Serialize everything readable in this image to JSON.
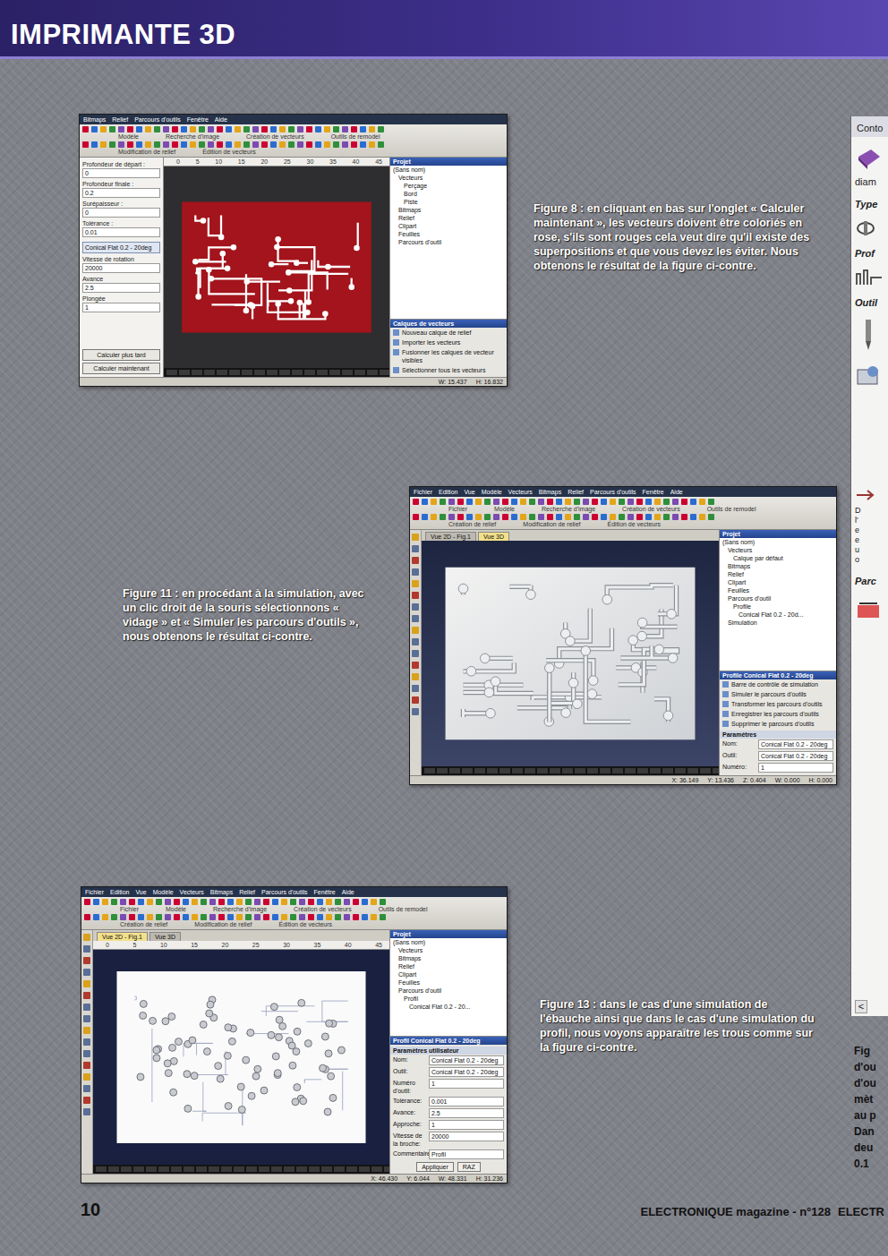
{
  "header": {
    "title": "IMPRIMANTE 3D"
  },
  "figures": [
    {
      "caption": "Figure 8 : en cliquant en bas sur l'onglet « Calculer maintenant », les vecteurs doivent être coloriés en rose, s'ils sont rouges cela veut dire qu'il existe des superpositions et que vous devez les éviter. Nous obtenons le résultat de la figure ci-contre.",
      "screen": {
        "menu": [
          "Bitmaps",
          "Relief",
          "Parcours d'outils",
          "Fenêtre",
          "Aide"
        ],
        "toolbar_labels": [
          "Modèle",
          "Recherche d'image",
          "Création de vecteurs",
          "Outils de remodel"
        ],
        "toolbar_labels_2": [
          "Modification de relief",
          "Édition de vecteurs"
        ],
        "left_toolbar": false,
        "form": {
          "fields": [
            {
              "label": "Profondeur de départ :",
              "value": "0"
            },
            {
              "label": "Profondeur finale :",
              "value": "0.2"
            },
            {
              "label": "Surépaisseur :",
              "value": "0"
            },
            {
              "label": "Tolérance :",
              "value": "0.01"
            }
          ],
          "tool": "Conical Flat 0.2 - 20deg",
          "tool_fields": [
            {
              "label": "Vitesse de rotation",
              "value": "20000"
            },
            {
              "label": "Avance",
              "value": "2.5"
            },
            {
              "label": "Plongée",
              "value": "1"
            }
          ],
          "buttons": [
            "Calculer plus tard",
            "Calculer maintenant"
          ]
        },
        "tabs": [],
        "ruler": [
          "0",
          "5",
          "10",
          "15",
          "20",
          "25",
          "30",
          "35",
          "40",
          "45"
        ],
        "canvas": {
          "kind": "vector"
        },
        "palette_strip": true,
        "tree_title": "Projet",
        "tree": [
          {
            "text": "(Sans nom)",
            "depth": 0
          },
          {
            "text": "Vecteurs",
            "depth": 1
          },
          {
            "text": "Perçage",
            "depth": 2
          },
          {
            "text": "Bord",
            "depth": 2
          },
          {
            "text": "Piste",
            "depth": 2
          },
          {
            "text": "Bitmaps",
            "depth": 1
          },
          {
            "text": "Relief",
            "depth": 1
          },
          {
            "text": "Clipart",
            "depth": 1
          },
          {
            "text": "Feuilles",
            "depth": 1
          },
          {
            "text": "Parcours d'outil",
            "depth": 1
          }
        ],
        "panel": {
          "title": "Calques de vecteurs",
          "items": [
            "Nouveau calque de relief",
            "Importer les vecteurs",
            "Fusionner les calques de vecteur visibles",
            "Sélectionner tous les vecteurs"
          ],
          "fields": [],
          "section": "",
          "buttons": []
        },
        "status": [
          "W: 15.437",
          "H: 16.832"
        ]
      }
    },
    {
      "caption": "Figure 11 : en procédant à la simulation, avec un clic droit de la souris sélectionnons « vidage » et « Simuler les parcours d'outils », nous obtenons le résultat ci-contre.",
      "screen": {
        "menu": [
          "Fichier",
          "Edition",
          "Vue",
          "Modèle",
          "Vecteurs",
          "Bitmaps",
          "Relief",
          "Parcours d'outils",
          "Fenêtre",
          "Aide"
        ],
        "toolbar_labels": [
          "Fichier",
          "Modèle",
          "Recherche d'image",
          "Création de vecteurs",
          "Outils de remodel"
        ],
        "toolbar_labels_2": [
          "Création de relief",
          "Modification de relief",
          "Édition de vecteurs"
        ],
        "left_toolbar": true,
        "form": null,
        "tabs": [
          {
            "label": "Vue 2D - Fig.1",
            "selected": false
          },
          {
            "label": "Vue 3D",
            "selected": true
          }
        ],
        "ruler": [],
        "canvas": {
          "kind": "relief"
        },
        "palette_strip": true,
        "tree_title": "Projet",
        "tree": [
          {
            "text": "(Sans nom)",
            "depth": 0
          },
          {
            "text": "Vecteurs",
            "depth": 1
          },
          {
            "text": "Calque par défaut",
            "depth": 2
          },
          {
            "text": "Bitmaps",
            "depth": 1
          },
          {
            "text": "Relief",
            "depth": 1
          },
          {
            "text": "Clipart",
            "depth": 1
          },
          {
            "text": "Feuilles",
            "depth": 1
          },
          {
            "text": "Parcours d'outil",
            "depth": 1
          },
          {
            "text": "Profile",
            "depth": 2
          },
          {
            "text": "Conical Flat 0.2 - 20d...",
            "depth": 3
          },
          {
            "text": "Simulation",
            "depth": 1
          }
        ],
        "panel": {
          "title": "Profile Conical Flat 0.2 - 20deg",
          "items": [
            "Barre de contrôle de simulation",
            "Simuler le parcours d'outils",
            "Transformer les parcours d'outils",
            "Enregistrer les parcours d'outils",
            "Supprimer le parcours d'outils"
          ],
          "fields": [
            {
              "label": "Nom:",
              "value": "Conical Flat 0.2 - 20deg"
            },
            {
              "label": "Outil:",
              "value": "Conical Flat 0.2 - 20deg"
            },
            {
              "label": "Numéro:",
              "value": "1"
            }
          ],
          "section": "Paramètres",
          "buttons": []
        },
        "status": [
          "X: 36.149",
          "Y: 13.436",
          "Z: 0.404",
          "W: 0.000",
          "H: 0.000"
        ]
      }
    },
    {
      "caption": "Figure 13 : dans le cas d'une simulation de l'ébauche ainsi que dans le cas d'une simulation du profil, nous voyons apparaître les trous comme sur la figure ci-contre.",
      "screen": {
        "menu": [
          "Fichier",
          "Edition",
          "Vue",
          "Modèle",
          "Vecteurs",
          "Bitmaps",
          "Relief",
          "Parcours d'outils",
          "Fenêtre",
          "Aide"
        ],
        "toolbar_labels": [
          "Fichier",
          "Modèle",
          "Recherche d'image",
          "Création de vecteurs",
          "Outils de remodel"
        ],
        "toolbar_labels_2": [
          "Création de relief",
          "Modification de relief",
          "Édition de vecteurs"
        ],
        "left_toolbar": true,
        "form": null,
        "tabs": [
          {
            "label": "Vue 2D - Fig.1",
            "selected": true
          },
          {
            "label": "Vue 3D",
            "selected": false
          }
        ],
        "ruler": [
          "0",
          "5",
          "10",
          "15",
          "20",
          "25",
          "30",
          "35",
          "40",
          "45"
        ],
        "canvas": {
          "kind": "holes"
        },
        "palette_strip": true,
        "tree_title": "Projet",
        "tree": [
          {
            "text": "(Sans nom)",
            "depth": 0
          },
          {
            "text": "Vecteurs",
            "depth": 1
          },
          {
            "text": "Bitmaps",
            "depth": 1
          },
          {
            "text": "Relief",
            "depth": 1
          },
          {
            "text": "Clipart",
            "depth": 1
          },
          {
            "text": "Feuilles",
            "depth": 1
          },
          {
            "text": "Parcours d'outil",
            "depth": 1
          },
          {
            "text": "Profil",
            "depth": 2
          },
          {
            "text": "Conical Flat 0.2 - 20...",
            "depth": 3
          }
        ],
        "panel": {
          "title": "Profil Conical Flat 0.2 - 20deg",
          "items": [],
          "fields": [
            {
              "label": "Nom:",
              "value": "Conical Flat 0.2 - 20deg"
            },
            {
              "label": "Outil:",
              "value": "Conical Flat 0.2 - 20deg"
            },
            {
              "label": "Numéro d'outil:",
              "value": "1"
            },
            {
              "label": "Tolérance:",
              "value": "0.001"
            },
            {
              "label": "Avance:",
              "value": "2.5"
            },
            {
              "label": "Approche:",
              "value": "1"
            },
            {
              "label": "Vitesse de la broche:",
              "value": "20000"
            },
            {
              "label": "Commentaire:",
              "value": "Profil"
            }
          ],
          "section": "Paramètres utilisateur",
          "buttons": [
            "Appliquer",
            "RAZ"
          ]
        },
        "status": [
          "X: 46.430",
          "Y: 6.044",
          "W: 48.331",
          "H: 31.236"
        ]
      }
    }
  ],
  "next_page": {
    "panel_items": [
      {
        "text": "Conto",
        "kind": "title"
      },
      {
        "text": "diam",
        "kind": "text"
      },
      {
        "text": "Type",
        "kind": "heading"
      },
      {
        "text": "Prof",
        "kind": "heading"
      },
      {
        "text": "Outil",
        "kind": "heading"
      },
      {
        "text": "D",
        "kind": "letter"
      },
      {
        "text": "l'",
        "kind": "letter"
      },
      {
        "text": "e",
        "kind": "letter"
      },
      {
        "text": "e",
        "kind": "letter"
      },
      {
        "text": "u",
        "kind": "letter"
      },
      {
        "text": "o",
        "kind": "letter"
      },
      {
        "text": "Parc",
        "kind": "heading"
      },
      {
        "text": "<",
        "kind": "scroll"
      }
    ],
    "caption_lines": [
      "Fig",
      "d'ou",
      "d'ou",
      "mèt",
      "au p",
      "Dan",
      "deu",
      "0.1"
    ]
  },
  "footer": {
    "page_number": "10",
    "magazine": "ELECTRONIQUE magazine - n°128",
    "next_magazine": "ELECTR"
  }
}
